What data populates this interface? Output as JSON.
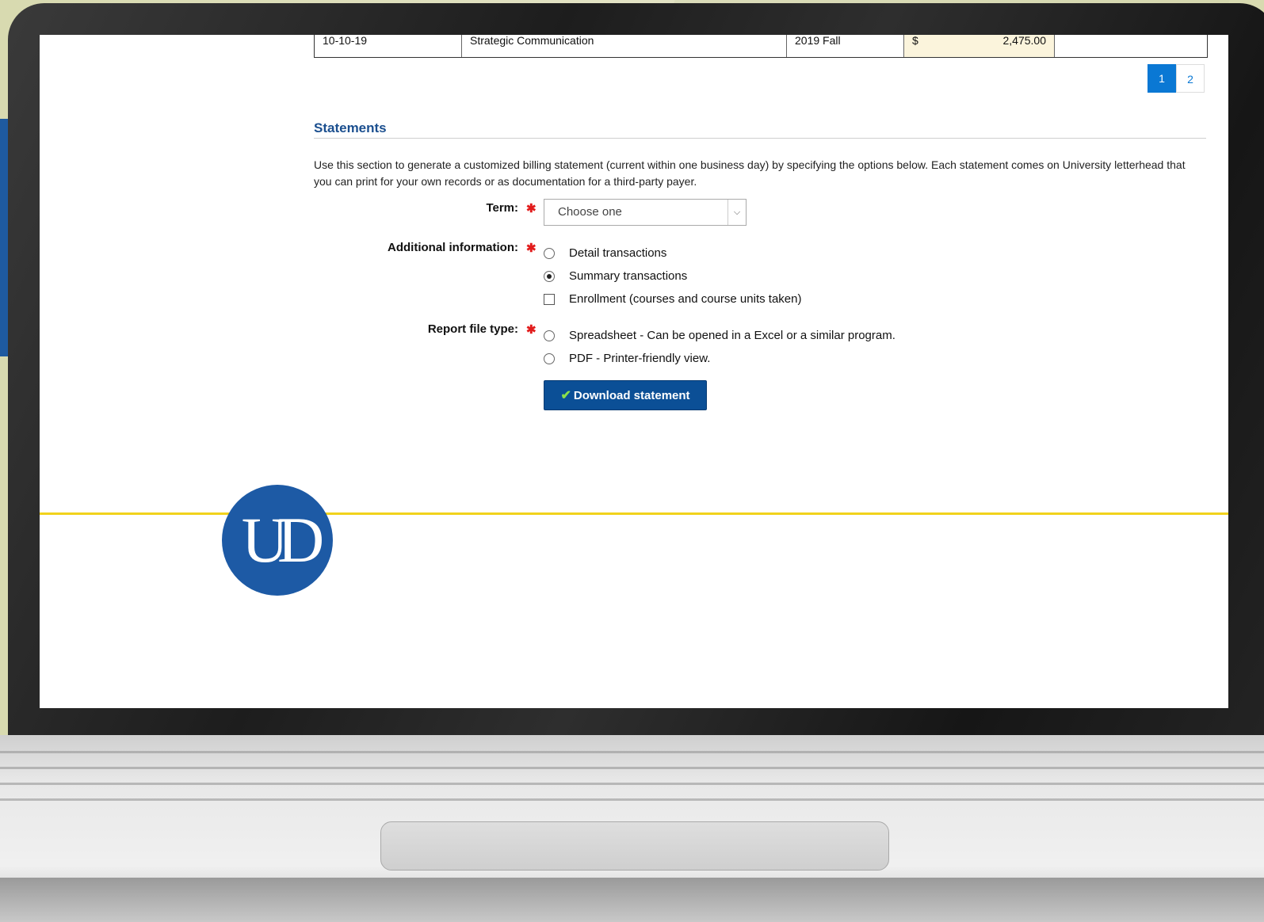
{
  "table": {
    "row": {
      "date": "10-10-19",
      "description": "Strategic Communication",
      "term": "2019 Fall",
      "currency": "$",
      "amount": "2,475.00"
    }
  },
  "pagination": {
    "pages": [
      "1",
      "2"
    ],
    "active": "1"
  },
  "statements": {
    "title": "Statements",
    "intro": "Use this section to generate a customized billing statement (current within one business day) by specifying the options below. Each statement comes on University letterhead that you can print for your own records or as documentation for a third-party payer.",
    "term_label": "Term:",
    "term_value": "Choose one",
    "required_mark": "✱",
    "additional_label": "Additional information:",
    "additional_options": [
      "Detail transactions",
      "Summary transactions",
      "Enrollment (courses and course units taken)"
    ],
    "filetype_label": "Report file type:",
    "filetype_options": [
      "Spreadsheet - Can be opened in a Excel or a similar program.",
      "PDF - Printer-friendly view."
    ],
    "download_label": "Download statement"
  },
  "logo_text": "UD",
  "colors": {
    "brand_blue": "#1d5aa5",
    "accent_gold": "#f1d21c",
    "button_blue": "#0b4f96",
    "pager_blue": "#0a78d4"
  }
}
